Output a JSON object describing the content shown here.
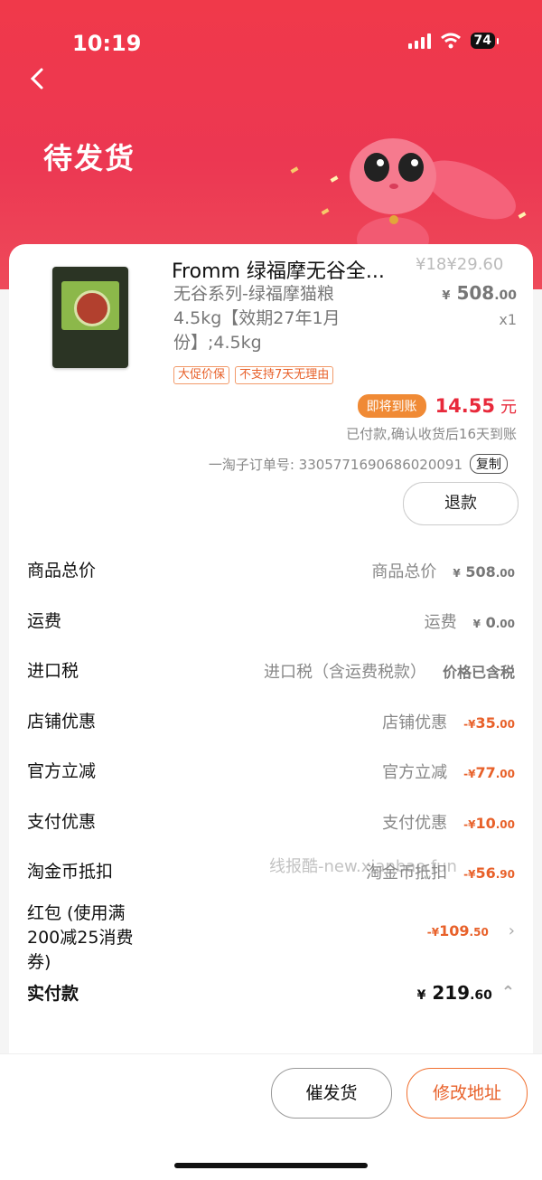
{
  "status": {
    "time": "10:19",
    "battery": "74"
  },
  "header": {
    "title": "待发货"
  },
  "product": {
    "cut_title": "Fromm 绿福摩无谷全...",
    "cut_price": "¥18¥29.60",
    "name": "无谷系列-绿福摩猫粮4.5kg【效期27年1月份】;4.5kg",
    "price_sym": "¥",
    "price_int": "508",
    "price_dec": ".00",
    "qty": "x1",
    "tags": [
      "大促价保",
      "不支持7天无理由"
    ],
    "pending_label": "即将到账",
    "pending_amount": "14.55",
    "pending_unit": "元",
    "pending_note": "已付款,确认收货后16天到账",
    "order_label": "一淘子订单号: 3305771690686020091",
    "copy_label": "复制",
    "refund_label": "退款"
  },
  "fees": [
    {
      "key": "商品总价",
      "label": "商品总价",
      "sym": "¥",
      "int": "508",
      "dec": ".00",
      "color": "gray"
    },
    {
      "key": "运费",
      "label": "运费",
      "sym": "¥",
      "int": "0",
      "dec": ".00",
      "color": "gray"
    },
    {
      "key": "进口税",
      "label": "进口税（含运费税款）",
      "note": "价格已含税"
    },
    {
      "key": "店铺优惠",
      "label": "店铺优惠",
      "sym": "-¥",
      "int": "35",
      "dec": ".00",
      "color": "red"
    },
    {
      "key": "官方立减",
      "label": "官方立减",
      "sym": "-¥",
      "int": "77",
      "dec": ".00",
      "color": "red"
    },
    {
      "key": "支付优惠",
      "label": "支付优惠",
      "sym": "-¥",
      "int": "10",
      "dec": ".00",
      "color": "red"
    },
    {
      "key": "淘金币抵扣",
      "label": "淘金币抵扣",
      "sym": "-¥",
      "int": "56",
      "dec": ".90",
      "color": "red"
    }
  ],
  "redpacket": {
    "key": "红包 (使用满200减25消费券)",
    "sym": "-¥",
    "int": "109",
    "dec": ".50"
  },
  "total": {
    "key": "实付款",
    "sym": "¥",
    "int": "219",
    "dec": ".60"
  },
  "watermark": "线报酷-new.xianbao.fun",
  "actions": {
    "urge": "催发货",
    "address": "修改地址"
  },
  "colors": {
    "header": "#ec3752",
    "accent": "#e8612a",
    "pending_badge": "#f08a35",
    "price_red": "#e8293b"
  }
}
